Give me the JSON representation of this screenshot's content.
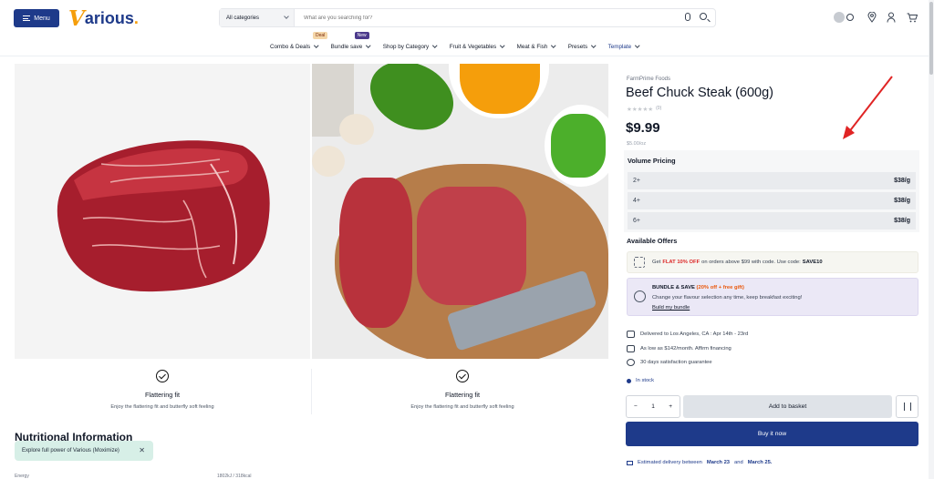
{
  "header": {
    "menu_label": "Menu",
    "logo_v": "V",
    "logo_rest": "arious",
    "logo_dot": ".",
    "search_category": "All categories",
    "search_placeholder": "What are you searching for?"
  },
  "nav": {
    "items": [
      {
        "label": "Combo & Deals",
        "badge": "Deal"
      },
      {
        "label": "Bundle save",
        "badge": "New"
      },
      {
        "label": "Shop by Category"
      },
      {
        "label": "Fruit & Vegetables"
      },
      {
        "label": "Meat & Fish"
      },
      {
        "label": "Presets"
      },
      {
        "label": "Template"
      }
    ]
  },
  "features": [
    {
      "title": "Flattering fit",
      "desc": "Enjoy the flattering fit and butterfly soft feeling"
    },
    {
      "title": "Flattering fit",
      "desc": "Enjoy the flattering fit and butterfly soft feeling"
    }
  ],
  "nutrition": {
    "heading": "Nutritional Information",
    "energy_label": "Energy",
    "energy_value": "1802kJ / 318kcal"
  },
  "toast": {
    "text": "Explore full power of Various (Moximize)",
    "close": "✕"
  },
  "product": {
    "brand": "FarmPrime Foods",
    "title": "Beef Chuck Steak (600g)",
    "stars": "★★★★★",
    "review_count": "(0)",
    "price": "$9.99",
    "unit_price": "$5.00/oz",
    "volume_heading": "Volume Pricing",
    "volume_rows": [
      {
        "qty": "2+",
        "price": "$38/g"
      },
      {
        "qty": "4+",
        "price": "$38/g"
      },
      {
        "qty": "6+",
        "price": "$38/g"
      }
    ],
    "offers_heading": "Available Offers",
    "offer1": {
      "pre": "Get",
      "highlight": "FLAT 10% OFF",
      "mid": "on orders above $99 with code. Use code:",
      "code": "SAVE10"
    },
    "offer2": {
      "title": "BUNDLE & SAVE",
      "highlight": "(20% off + free gift)",
      "desc": "Change your flavour selection any time, keep breakfast exciting!",
      "link": "Build my bundle"
    },
    "delivery": "Delivered to Los Angeles, CA : Apr 14th - 23rd",
    "affirm": "As low as $142/month. Affirm financing",
    "guarantee": "30 days satisfaction guarantee",
    "stock": "In stock",
    "qty_minus": "−",
    "qty_value": "1",
    "qty_plus": "+",
    "add_label": "Add to basket",
    "buy_label": "Buy it now",
    "est_pre": "Estimated delivery between",
    "est_date1": "March 23",
    "est_and": "and",
    "est_date2": "March 25."
  },
  "colors": {
    "brand_blue": "#1e3a8a",
    "logo_orange": "#f59e0b",
    "annotation_red": "#e02424"
  },
  "icons": [
    "menu-icon",
    "chevron-down-icon",
    "microphone-icon",
    "search-icon",
    "theme-toggle-icon",
    "location-pin-icon",
    "user-icon",
    "cart-icon",
    "checkmark-circle-icon",
    "star-icon",
    "coupon-icon",
    "gift-icon",
    "truck-icon",
    "card-icon",
    "shield-check-icon",
    "compare-icon",
    "box-icon"
  ]
}
